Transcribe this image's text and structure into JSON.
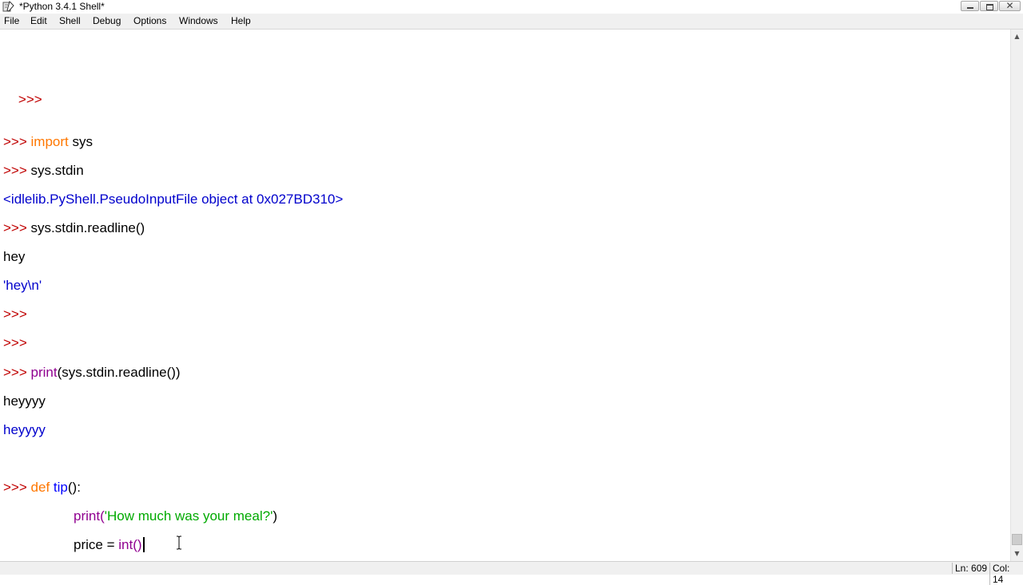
{
  "window": {
    "title": "*Python 3.4.1 Shell*"
  },
  "menu": {
    "items": [
      "File",
      "Edit",
      "Shell",
      "Debug",
      "Options",
      "Windows",
      "Help"
    ]
  },
  "shell": {
    "prompt": ">>>",
    "lines": {
      "l1_prompt": ">>>",
      "l2_prompt": ">>>",
      "l2_kw": "import",
      "l2_rest": " sys",
      "l3_prompt": ">>>",
      "l3_code": " sys.stdin",
      "l4_out": "<idlelib.PyShell.PseudoInputFile object at 0x027BD310>",
      "l5_prompt": ">>>",
      "l5_code": " sys.stdin.readline()",
      "l6_input": "hey",
      "l7_out": "'hey\\n'",
      "l8_prompt": ">>>",
      "l9_prompt": ">>>",
      "l10_prompt": ">>>",
      "l10_builtin": "print",
      "l10_rest": "(sys.stdin.readline())",
      "l11_input": "heyyyy",
      "l12_out": "heyyyy",
      "l13_prompt": ">>>",
      "l13_kw": "def",
      "l13_name": "tip",
      "l13_rest": "():",
      "l14_builtin": "print",
      "l14_open": "(",
      "l14_str": "'How much was your meal?'",
      "l14_close": ")",
      "l15_code": "price = ",
      "l15_builtin": "int",
      "l15_rest": "()"
    }
  },
  "status": {
    "line": "Ln: 609",
    "col": "Col: 14"
  },
  "colors": {
    "prompt": "#c00000",
    "keyword": "#ff7700",
    "builtin": "#900090",
    "definition": "#0000ff",
    "string": "#00aa00",
    "output": "#0000cc"
  },
  "icons": {
    "app": "python-feather-icon",
    "minimize": "minimize-icon",
    "maximize": "restore-icon",
    "close": "close-icon"
  }
}
